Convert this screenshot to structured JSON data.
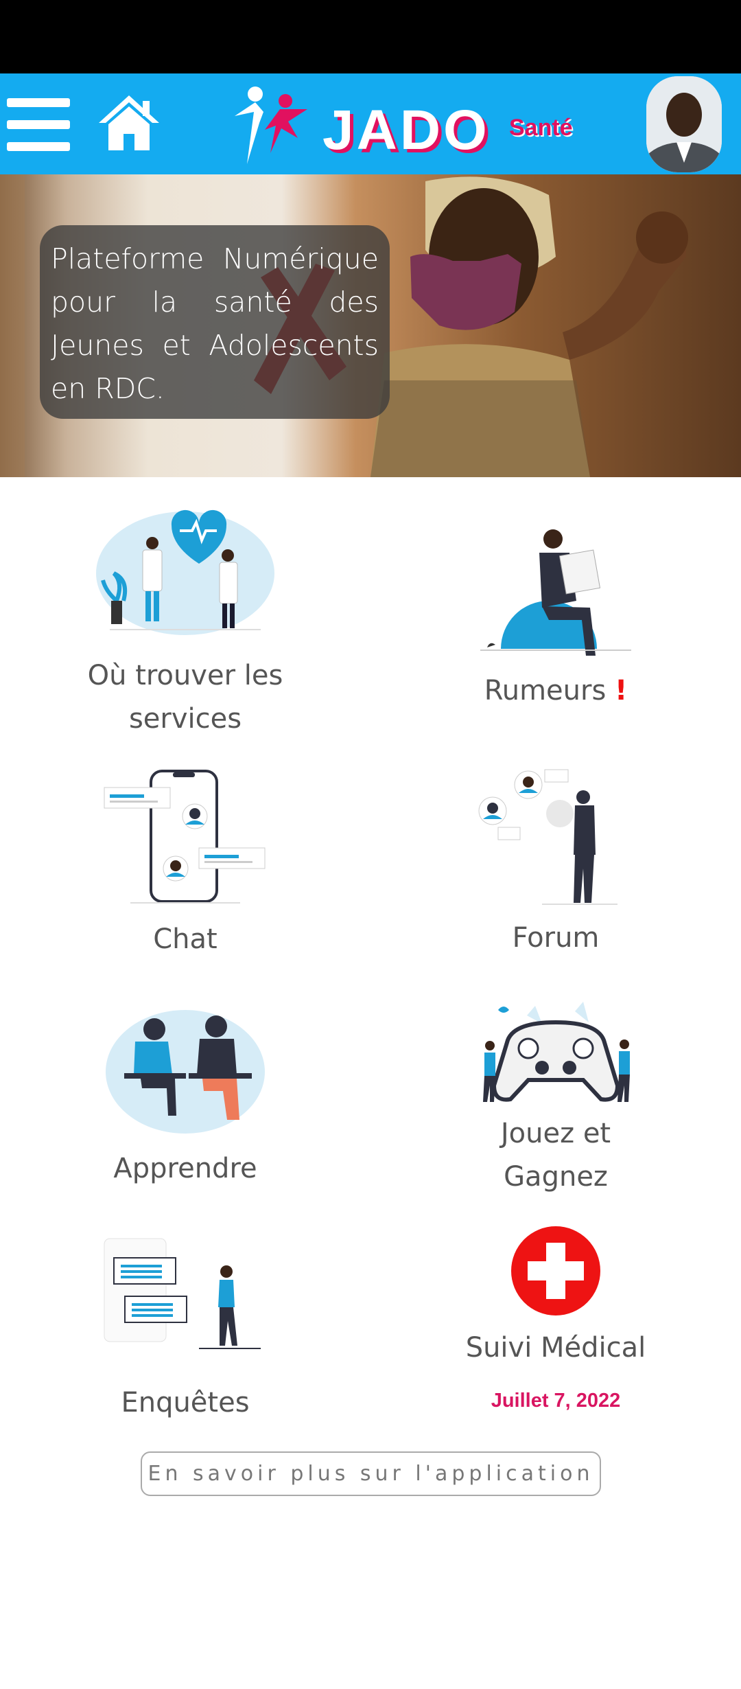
{
  "header": {
    "app_name": "JADO",
    "app_subtitle": "Santé",
    "menu_icon": "hamburger-menu-icon",
    "home_icon": "home-icon",
    "brand_colors": {
      "bar": "#14abf0",
      "accent": "#e1115f"
    }
  },
  "hero": {
    "text": "Plateforme Numérique pour la santé des Jeunes et Adolescents en RDC."
  },
  "tiles": [
    {
      "label": "Où trouver les services",
      "icon": "doctors-illustration-icon"
    },
    {
      "label": "Rumeurs",
      "suffix": "!",
      "icon": "newspaper-reader-illustration-icon"
    },
    {
      "label": "Chat",
      "icon": "phone-chat-illustration-icon"
    },
    {
      "label": "Forum",
      "icon": "forum-discussion-illustration-icon"
    },
    {
      "label": "Apprendre",
      "icon": "students-learning-illustration-icon"
    },
    {
      "label": "Jouez et Gagnez",
      "icon": "game-controller-illustration-icon"
    },
    {
      "label": "Enquêtes",
      "icon": "survey-illustration-icon"
    },
    {
      "label": "Suivi Médical",
      "icon": "medical-cross-icon"
    }
  ],
  "date": "Juillet 7, 2022",
  "more_button": "En savoir plus sur l'application"
}
